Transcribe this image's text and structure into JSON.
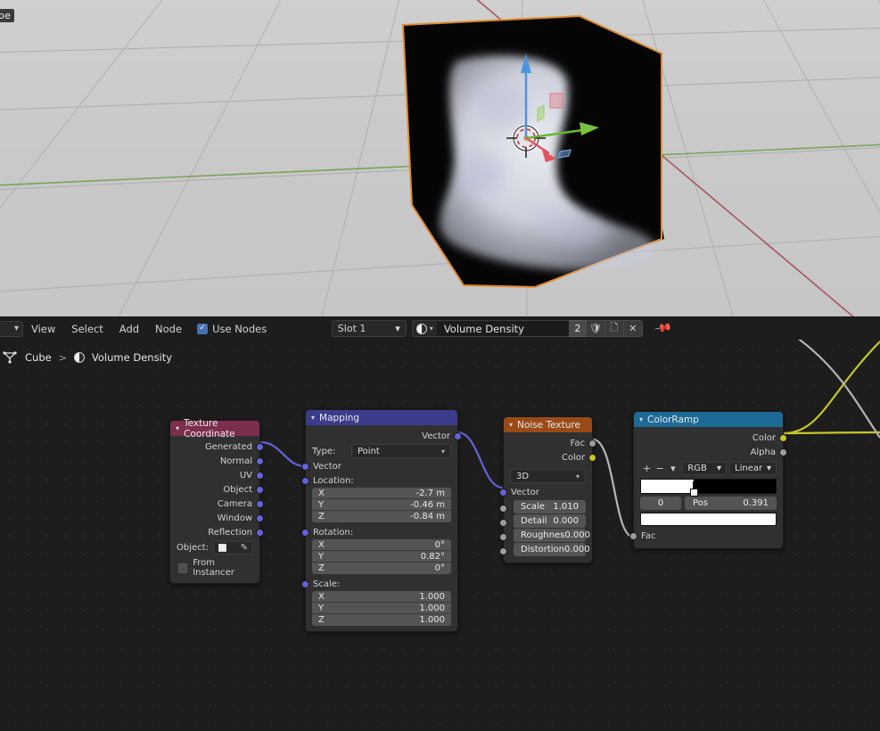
{
  "viewport": {
    "corner_label": "be",
    "object_name": "Cube"
  },
  "node_editor_header": {
    "editor_type_icon": "editor-type-chevron",
    "menus": [
      "View",
      "Select",
      "Add",
      "Node"
    ],
    "use_nodes_label": "Use Nodes",
    "use_nodes_checked": true,
    "slot_label": "Slot 1",
    "slot_chevron": "⌄",
    "material_icon": "material-sphere-icon",
    "material_name": "Volume Density",
    "users_count": "2",
    "fake_user_icon": "shield-icon",
    "new_material_icon": "copy-icon",
    "unlink_icon": "x-icon",
    "pin_icon": "pin-icon"
  },
  "breadcrumb": {
    "object_icon": "mesh-data-icon",
    "object": "Cube",
    "separator": ">",
    "material_icon": "material-sphere-icon",
    "material": "Volume Density"
  },
  "nodes": {
    "texture_coordinate": {
      "title": "Texture Coordinate",
      "header_color": "#7b2e4d",
      "outputs": [
        "Generated",
        "Normal",
        "UV",
        "Object",
        "Camera",
        "Window",
        "Reflection"
      ],
      "object_label": "Object:",
      "object_value": "",
      "eyedropper_icon": "eyedropper-icon",
      "from_instancer_label": "From Instancer",
      "from_instancer_checked": false
    },
    "mapping": {
      "title": "Mapping",
      "header_color": "#3c3c8c",
      "output_label": "Vector",
      "type_label": "Type:",
      "type_value": "Point",
      "input_label": "Vector",
      "location_label": "Location:",
      "location": [
        {
          "axis": "X",
          "value": "-2.7 m"
        },
        {
          "axis": "Y",
          "value": "-0.46 m"
        },
        {
          "axis": "Z",
          "value": "-0.84 m"
        }
      ],
      "rotation_label": "Rotation:",
      "rotation": [
        {
          "axis": "X",
          "value": "0°"
        },
        {
          "axis": "Y",
          "value": "0.82°"
        },
        {
          "axis": "Z",
          "value": "0°"
        }
      ],
      "scale_label": "Scale:",
      "scale": [
        {
          "axis": "X",
          "value": "1.000"
        },
        {
          "axis": "Y",
          "value": "1.000"
        },
        {
          "axis": "Z",
          "value": "1.000"
        }
      ]
    },
    "noise_texture": {
      "title": "Noise Texture",
      "header_color": "#9a4a17",
      "outputs": [
        {
          "label": "Fac",
          "type": "float"
        },
        {
          "label": "Color",
          "type": "color"
        }
      ],
      "dimension_value": "3D",
      "input_vector_label": "Vector",
      "params": [
        {
          "label": "Scale",
          "value": "1.010"
        },
        {
          "label": "Detail",
          "value": "0.000"
        },
        {
          "label": "Roughnes",
          "value": "0.000"
        },
        {
          "label": "Distortion",
          "value": "0.000"
        }
      ]
    },
    "color_ramp": {
      "title": "ColorRamp",
      "header_color": "#1d6a96",
      "outputs": [
        {
          "label": "Color",
          "type": "color"
        },
        {
          "label": "Alpha",
          "type": "float"
        }
      ],
      "add_icon": "plus-icon",
      "remove_icon": "minus-icon",
      "menu_icon": "chevron-down-icon",
      "color_mode": "RGB",
      "interpolation": "Linear",
      "gradient_from": "#ffffff",
      "gradient_to": "#000000",
      "stop_index": "0",
      "pos_label": "Pos",
      "pos_value": "0.391",
      "selected_color": "#ffffff",
      "input_label": "Fac"
    }
  }
}
